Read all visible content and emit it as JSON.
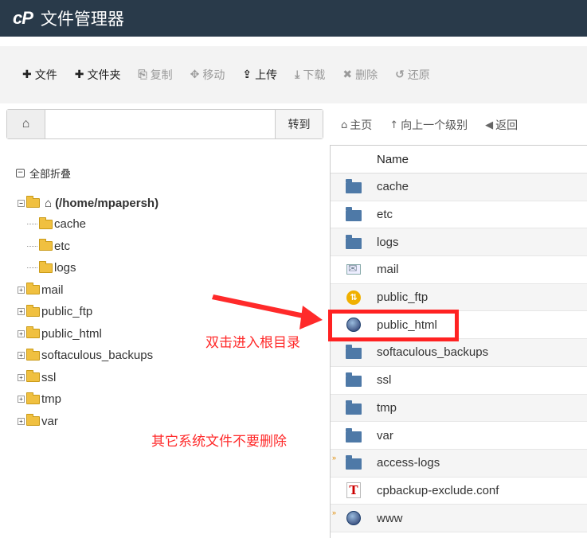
{
  "header": {
    "logo": "cP",
    "title": "文件管理器"
  },
  "toolbar": {
    "new_file": "文件",
    "new_folder": "文件夹",
    "copy": "复制",
    "move": "移动",
    "upload": "上传",
    "download": "下载",
    "delete": "删除",
    "restore": "还原"
  },
  "pathbar": {
    "value": "",
    "go_label": "转到"
  },
  "nav": {
    "home": "主页",
    "up": "向上一个级别",
    "back": "返回"
  },
  "tree": {
    "collapse_label": "全部折叠",
    "root_label": "(/home/mpapersh)",
    "items": [
      {
        "label": "cache",
        "expandable": false
      },
      {
        "label": "etc",
        "expandable": false
      },
      {
        "label": "logs",
        "expandable": false
      },
      {
        "label": "mail",
        "expandable": true
      },
      {
        "label": "public_ftp",
        "expandable": true
      },
      {
        "label": "public_html",
        "expandable": true
      },
      {
        "label": "softaculous_backups",
        "expandable": true
      },
      {
        "label": "ssl",
        "expandable": true
      },
      {
        "label": "tmp",
        "expandable": true
      },
      {
        "label": "var",
        "expandable": true
      }
    ]
  },
  "filelist": {
    "header_name": "Name",
    "rows": [
      {
        "name": "cache",
        "icon": "folder-icon"
      },
      {
        "name": "etc",
        "icon": "folder-icon"
      },
      {
        "name": "logs",
        "icon": "folder-icon"
      },
      {
        "name": "mail",
        "icon": "mail-icon"
      },
      {
        "name": "public_ftp",
        "icon": "ftp-icon"
      },
      {
        "name": "public_html",
        "icon": "globe-icon"
      },
      {
        "name": "softaculous_backups",
        "icon": "folder-icon"
      },
      {
        "name": "ssl",
        "icon": "folder-icon"
      },
      {
        "name": "tmp",
        "icon": "folder-icon"
      },
      {
        "name": "var",
        "icon": "folder-icon"
      },
      {
        "name": "access-logs",
        "icon": "folder-icon"
      },
      {
        "name": "cpbackup-exclude.conf",
        "icon": "text-file-icon"
      },
      {
        "name": "www",
        "icon": "globe-icon"
      }
    ]
  },
  "annotations": {
    "double_click_hint": "双击进入根目录",
    "warning": "其它系统文件不要删除"
  },
  "colors": {
    "header_bg": "#293a4a",
    "annotation_red": "#ff2222"
  }
}
